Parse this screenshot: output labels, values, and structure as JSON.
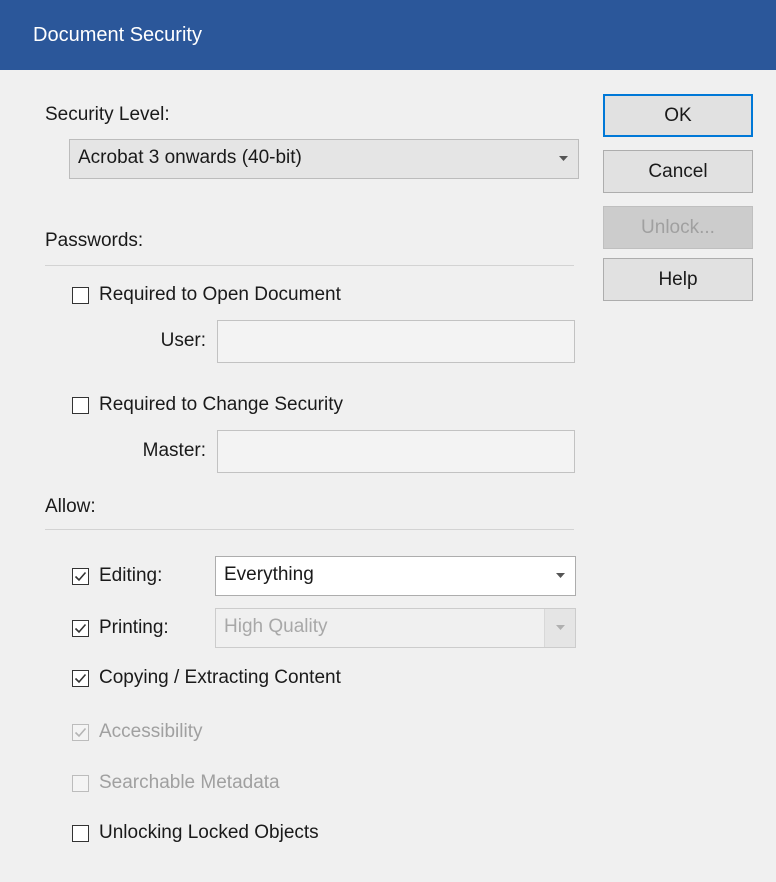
{
  "window": {
    "title": "Document Security"
  },
  "security_level": {
    "label": "Security Level:",
    "value": "Acrobat 3 onwards (40-bit)"
  },
  "buttons": {
    "ok": "OK",
    "cancel": "Cancel",
    "unlock": "Unlock...",
    "help": "Help"
  },
  "passwords": {
    "label": "Passwords:",
    "open_document": {
      "label": "Required to Open Document",
      "checked": false
    },
    "user_label": "User:",
    "user_value": "",
    "change_security": {
      "label": "Required to Change Security",
      "checked": false
    },
    "master_label": "Master:",
    "master_value": ""
  },
  "allow": {
    "label": "Allow:",
    "editing": {
      "label": "Editing:",
      "checked": true,
      "value": "Everything"
    },
    "printing": {
      "label": "Printing:",
      "checked": true,
      "value": "High Quality",
      "enabled": false
    },
    "copying": {
      "label": "Copying / Extracting Content",
      "checked": true
    },
    "accessibility": {
      "label": "Accessibility",
      "checked": true,
      "enabled": false
    },
    "searchable_metadata": {
      "label": "Searchable Metadata",
      "checked": false,
      "enabled": false
    },
    "unlocking_locked_objects": {
      "label": "Unlocking Locked Objects",
      "checked": false
    }
  },
  "colors": {
    "titlebar": "#2b579a",
    "focus_border": "#0078d7",
    "dialog_bg": "#f0f0f0"
  }
}
